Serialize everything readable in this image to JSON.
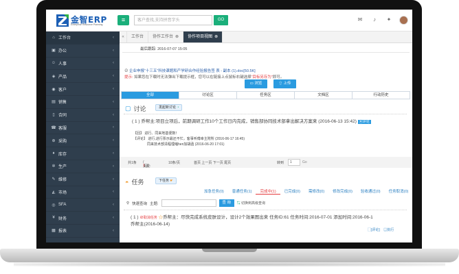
{
  "header": {
    "logo_text": "金智ERP",
    "logo_sub": "Enterprise Resource Planning",
    "menu_icon": "hamburger-icon",
    "search_placeholder": "客户查找,支持拼音字头",
    "go_label": "GO"
  },
  "sidebar": {
    "items": [
      {
        "label": "工作台",
        "icon": "home-icon"
      },
      {
        "label": "办公",
        "icon": "briefcase-icon"
      },
      {
        "label": "人事",
        "icon": "users-icon"
      },
      {
        "label": "产品",
        "icon": "cube-icon"
      },
      {
        "label": "客户",
        "icon": "signal-icon"
      },
      {
        "label": "销售",
        "icon": "chart-icon"
      },
      {
        "label": "合同",
        "icon": "file-icon"
      },
      {
        "label": "客服",
        "icon": "phone-icon"
      },
      {
        "label": "采购",
        "icon": "cart-icon"
      },
      {
        "label": "库存",
        "icon": "truck-icon"
      },
      {
        "label": "生产",
        "icon": "gear-icon"
      },
      {
        "label": "维修",
        "icon": "wrench-icon"
      },
      {
        "label": "市场",
        "icon": "bullhorn-icon"
      },
      {
        "label": "SFA",
        "icon": "sfa-icon"
      },
      {
        "label": "财务",
        "icon": "money-icon"
      },
      {
        "label": "报表",
        "icon": "report-icon"
      }
    ]
  },
  "tabs": {
    "items": [
      {
        "label": "工作台"
      },
      {
        "label": "协作工作台"
      },
      {
        "label": "协作项目视图"
      }
    ]
  },
  "project": {
    "latest_reply_label": "最后跟踪:",
    "latest_reply_time": "2016-07-07 15:05",
    "attachment": "企业申报“十三五”科技课题和产学研合作经验报告签 表 - 副本 (1).doc[50.5K]",
    "hint_label": "提示:",
    "hint_text": "如果您在下载时无法弹出下载提示框，您可以在链接上点鼠标右键选择",
    "hint_link": "“目标另存为”",
    "hint_suffix": "即可。",
    "browse_label": "浏览",
    "upload_label": "上传"
  },
  "section_tabs": [
    "全部",
    "讨论区",
    "任务区",
    "文档区",
    "行动历史"
  ],
  "discussion": {
    "title": "讨论",
    "new_button": "发起新讨论",
    "entry": "( 1 ) 乔帮主:项目立项后，前期调研工作10个工作日内完成，销售部协同技术部拿出解决方案来 (2016-06-13 15:42)",
    "reply_link": "评论",
    "reply_label": "【回】",
    "reply_text": "进行、同来地基便数！",
    "comment_label": "【评论】",
    "comment_1": "进行,进行票示最还不忙，客事听傅幸主附所 (2016-06-17 16:45)",
    "comment_2": "同来技术部清程理缩hen加胡函 (2016-06-20 17:01)"
  },
  "pager": {
    "total": "共1条",
    "pages_prefix": "页次:",
    "page_current": "1",
    "page_total": "1页",
    "per_page": "10条/页",
    "nav": "首页 上一页 下一页 尾页",
    "jump_label": "转到",
    "page_input": "1",
    "go_label": "Go"
  },
  "tasks": {
    "title": "任务",
    "new_button": "下任务",
    "status_tabs": [
      {
        "label": "加急任务(0)"
      },
      {
        "label": "普通任务(1)"
      },
      {
        "label": "完成中(1)"
      },
      {
        "label": "已完成(0)"
      },
      {
        "label": "需修改(0)"
      },
      {
        "label": "修改完成(0)"
      },
      {
        "label": "验收通过(0)"
      },
      {
        "label": "任务取消(0)"
      }
    ],
    "quick_search_label": "快速查询",
    "theme_label": "主题:",
    "query_button": "查 询",
    "advanced_link": "切换到高级查询",
    "entry_prefix": "( 1 )",
    "entry_status": "取消任务",
    "entry_text": "乔帮主：尽快完成系统皮肤设计，设计2个效果图出来 任务ID:61 任务时间:2016-07-01 添加时间:2016-06-1",
    "entry_text_2": "乔帮主(2016-06-14)",
    "action_comment": "[评论]",
    "action_run": "执行"
  }
}
